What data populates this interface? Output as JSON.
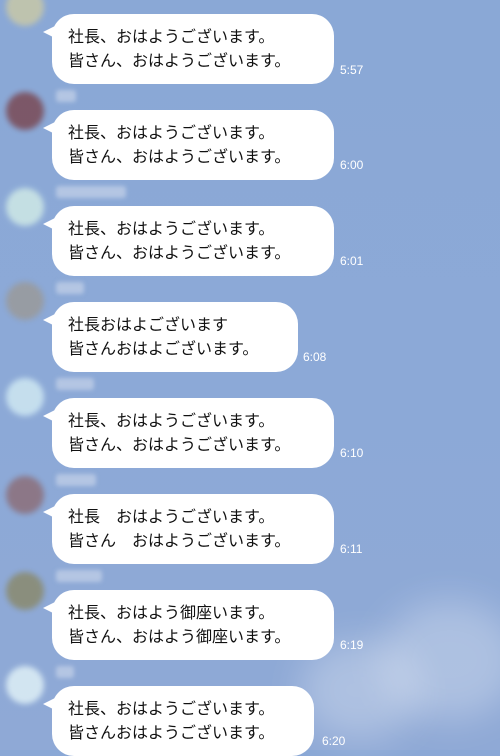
{
  "colors": {
    "background": "#8CA9D7",
    "bubble": "#FFFFFF",
    "time_text": "#FFFFFF"
  },
  "messages": [
    {
      "line1": "社長、おはようございます。",
      "line2": "皆さん、おはようございます。",
      "time": "5:57"
    },
    {
      "line1": "社長、おはようございます。",
      "line2": "皆さん、おはようございます。",
      "time": "6:00"
    },
    {
      "line1": "社長、おはようございます。",
      "line2": "皆さん、おはようございます。",
      "time": "6:01"
    },
    {
      "line1": "社長おはよございます",
      "line2": "皆さんおはよございます。",
      "time": "6:08"
    },
    {
      "line1": "社長、おはようございます。",
      "line2": "皆さん、おはようございます。",
      "time": "6:10"
    },
    {
      "line1": "社長　おはようございます。",
      "line2": "皆さん　おはようございます。",
      "time": "6:11"
    },
    {
      "line1": "社長、おはよう御座います。",
      "line2": "皆さん、おはよう御座います。",
      "time": "6:19"
    },
    {
      "line1": "社長、おはようございます。",
      "line2": "皆さんおはようございます。",
      "time": "6:20"
    }
  ]
}
